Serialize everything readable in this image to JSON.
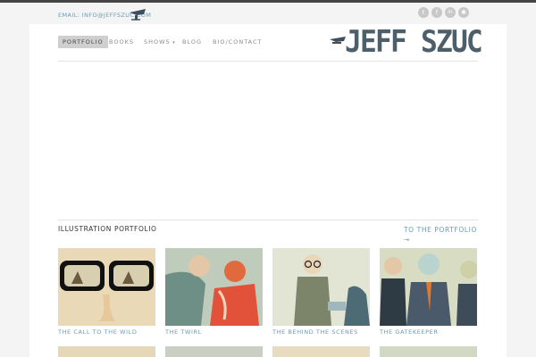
{
  "header": {
    "email_text": "EMAIL: INFO@JEFFSZUC.COM",
    "brand_title": "JEFF SZUC",
    "social": [
      {
        "name": "twitter-icon",
        "glyph": "t"
      },
      {
        "name": "facebook-icon",
        "glyph": "f"
      },
      {
        "name": "linkedin-icon",
        "glyph": "in"
      },
      {
        "name": "delicious-icon",
        "glyph": "✱"
      }
    ]
  },
  "nav": {
    "items": [
      "PORTFOLIO",
      "BOOKS",
      "SHOWS",
      "BLOG",
      "BIO/CONTACT"
    ],
    "active": "PORTFOLIO"
  },
  "portfolio": {
    "section_title": "ILLUSTRATION PORTFOLIO",
    "link_label": "TO THE PORTFOLIO →",
    "items": [
      {
        "caption": "THE CALL TO THE WILD"
      },
      {
        "caption": "THE TWIRL"
      },
      {
        "caption": "THE BEHIND THE SCENES"
      },
      {
        "caption": "THE GATEKEEPER"
      }
    ]
  }
}
